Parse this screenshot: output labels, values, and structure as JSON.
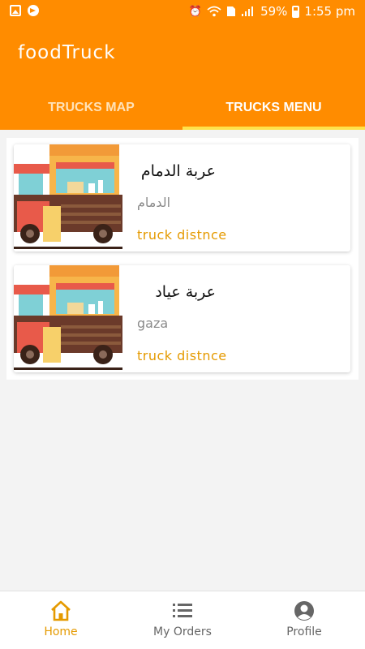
{
  "status_bar": {
    "battery": "59%",
    "time": "1:55 pm",
    "icons": [
      "gallery-icon",
      "telegram-icon",
      "alarm-icon",
      "wifi-icon",
      "sim-icon",
      "signal-icon",
      "battery-icon"
    ]
  },
  "app": {
    "title": "foodTruck",
    "accent_color": "#ff8c00",
    "tab_indicator_color": "#ffe24a"
  },
  "tabs": [
    {
      "label": "TRUCKS MAP",
      "active": false
    },
    {
      "label": "TRUCKS MENU",
      "active": true
    }
  ],
  "trucks": [
    {
      "name": "عربة الدمام",
      "city": "الدمام",
      "distance": "truck distnce",
      "icon": "food-truck-image"
    },
    {
      "name": "عربة عياد",
      "city": "gaza",
      "distance": "truck distnce",
      "icon": "food-truck-image"
    }
  ],
  "bottom_nav": [
    {
      "label": "Home",
      "icon": "home-icon",
      "active": true
    },
    {
      "label": "My Orders",
      "icon": "list-icon",
      "active": false
    },
    {
      "label": "Profile",
      "icon": "profile-icon",
      "active": false
    }
  ]
}
